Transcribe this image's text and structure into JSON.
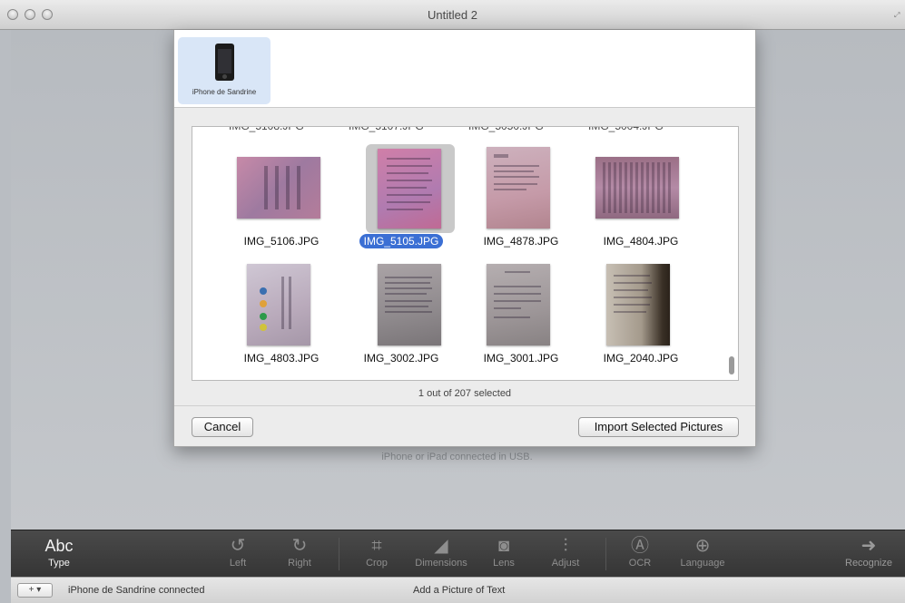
{
  "window": {
    "title": "Untitled 2"
  },
  "background": {
    "hint_line": "iPhone or iPad connected in USB."
  },
  "dialog": {
    "device": {
      "name": "iPhone de Sandrine",
      "icon": "iphone-icon"
    },
    "photos": [
      {
        "name": "IMG_5106.JPG",
        "selected": false
      },
      {
        "name": "IMG_5105.JPG",
        "selected": true
      },
      {
        "name": "IMG_4878.JPG",
        "selected": false
      },
      {
        "name": "IMG_4804.JPG",
        "selected": false
      },
      {
        "name": "IMG_4803.JPG",
        "selected": false
      },
      {
        "name": "IMG_3002.JPG",
        "selected": false
      },
      {
        "name": "IMG_3001.JPG",
        "selected": false
      },
      {
        "name": "IMG_2040.JPG",
        "selected": false
      }
    ],
    "selection_status": "1 out of 207 selected",
    "cancel_label": "Cancel",
    "import_label": "Import Selected Pictures"
  },
  "toolbar": {
    "type": {
      "glyph": "Abc",
      "label": "Type"
    },
    "left": {
      "label": "Left",
      "icon": "rotate-left-icon"
    },
    "right": {
      "label": "Right",
      "icon": "rotate-right-icon"
    },
    "crop": {
      "label": "Crop",
      "icon": "crop-icon"
    },
    "dimensions": {
      "label": "Dimensions",
      "icon": "dimensions-icon"
    },
    "lens": {
      "label": "Lens",
      "icon": "camera-icon"
    },
    "adjust": {
      "label": "Adjust",
      "icon": "sliders-icon"
    },
    "ocr": {
      "label": "OCR",
      "icon": "ocr-icon"
    },
    "language": {
      "label": "Language",
      "icon": "globe-icon"
    },
    "recognize": {
      "label": "Recognize",
      "icon": "arrow-right-circle-icon"
    }
  },
  "statusbar": {
    "left_text": "iPhone de Sandrine connected",
    "center_text": "Add a Picture of Text",
    "control": "+ ▾"
  },
  "colors": {
    "selection_blue": "#3b6fd4",
    "toolbar_bg": "#3f3f3f"
  }
}
